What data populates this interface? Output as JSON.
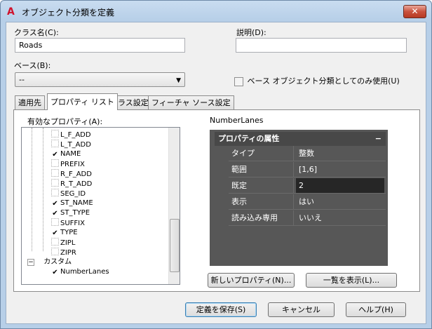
{
  "window": {
    "title": "オブジェクト分類を定義",
    "close_label": "✕"
  },
  "class_name": {
    "label": "クラス名(C):",
    "value": "Roads"
  },
  "description": {
    "label": "説明(D):",
    "value": ""
  },
  "base": {
    "label": "ベース(B):",
    "value": "--"
  },
  "base_only_checkbox": {
    "label": "ベース オブジェクト分類としてのみ使用(U)",
    "checked": false
  },
  "tabs": [
    {
      "label": "適用先"
    },
    {
      "label": "プロパティ リスト"
    },
    {
      "label": "クラス設定"
    },
    {
      "label": "フィーチャ ソース設定"
    }
  ],
  "properties_tree": {
    "label": "有効なプロパティ(A):",
    "items": [
      {
        "label": "L_F_ADD",
        "checked": false
      },
      {
        "label": "L_T_ADD",
        "checked": false
      },
      {
        "label": "NAME",
        "checked": true
      },
      {
        "label": "PREFIX",
        "checked": false
      },
      {
        "label": "R_F_ADD",
        "checked": false
      },
      {
        "label": "R_T_ADD",
        "checked": false
      },
      {
        "label": "SEG_ID",
        "checked": false
      },
      {
        "label": "ST_NAME",
        "checked": true
      },
      {
        "label": "ST_TYPE",
        "checked": true
      },
      {
        "label": "SUFFIX",
        "checked": false
      },
      {
        "label": "TYPE",
        "checked": true
      },
      {
        "label": "ZIPL",
        "checked": false
      },
      {
        "label": "ZIPR",
        "checked": false
      }
    ],
    "custom_group": {
      "label": "カスタム",
      "expander": "−"
    },
    "custom_items": [
      {
        "label": "NumberLanes",
        "checked": true
      }
    ]
  },
  "selected_property": {
    "name": "NumberLanes",
    "panel_title": "プロパティの属性",
    "collapse_label": "−",
    "rows": [
      {
        "key": "タイプ",
        "value": "整数"
      },
      {
        "key": "範囲",
        "value": "[1,6]"
      },
      {
        "key": "既定",
        "value": "2"
      },
      {
        "key": "表示",
        "value": "はい"
      },
      {
        "key": "読み込み専用",
        "value": "いいえ"
      }
    ]
  },
  "buttons": {
    "new_property": "新しいプロパティ(N)...",
    "show_list": "一覧を表示(L)...",
    "save": "定義を保存(S)",
    "cancel": "キャンセル",
    "help": "ヘルプ(H)"
  }
}
